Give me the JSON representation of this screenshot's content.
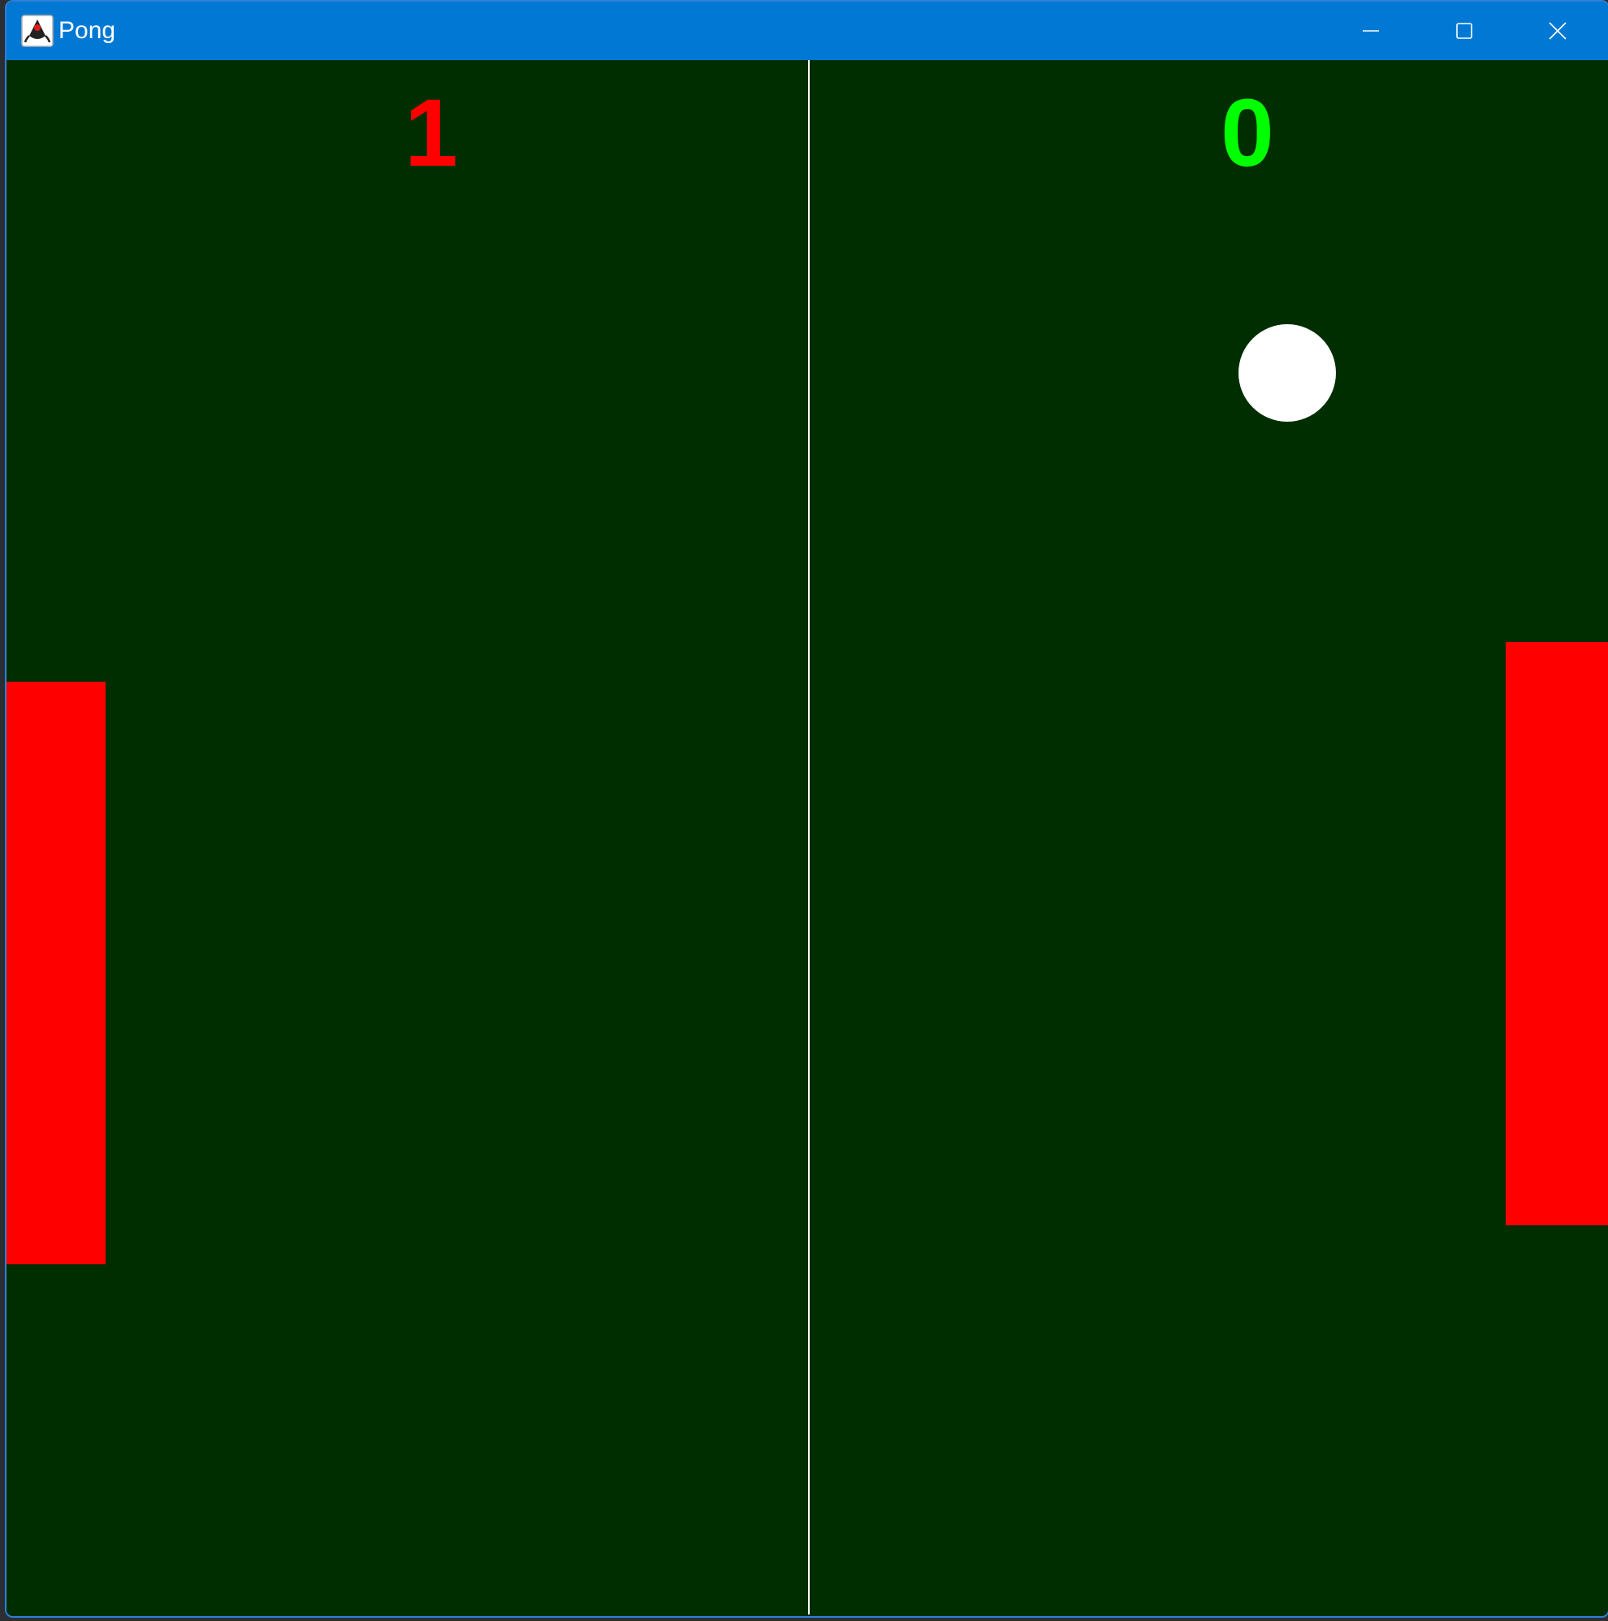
{
  "window": {
    "title": "Pong",
    "icon": "java-duke-icon",
    "controls": [
      "minimize-icon",
      "maximize-icon",
      "close-icon"
    ],
    "titlebar_color": "#0078d4"
  },
  "game": {
    "background_color": "#002e00",
    "score_left": "1",
    "score_right": "0",
    "score_left_color": "#ff0000",
    "score_right_color": "#00ff00",
    "paddle_color": "#ff0000",
    "ball_color": "#ffffff",
    "center_line_color": "#ffffff"
  }
}
